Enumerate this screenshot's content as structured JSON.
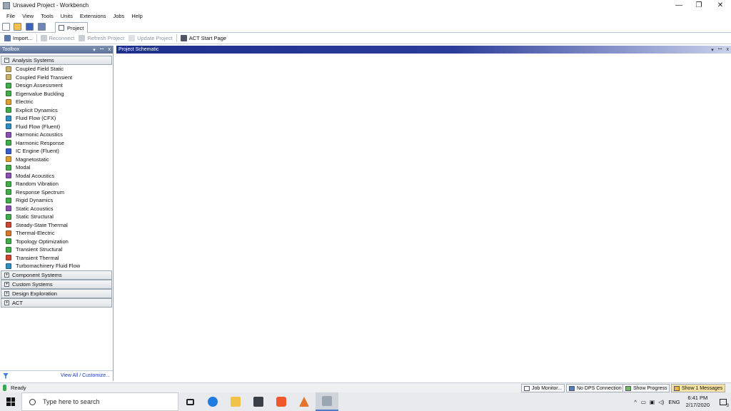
{
  "window": {
    "title": "Unsaved Project - Workbench",
    "min": "—",
    "restore": "❐",
    "close": "✕"
  },
  "menu": [
    "File",
    "View",
    "Tools",
    "Units",
    "Extensions",
    "Jobs",
    "Help"
  ],
  "tab": {
    "label": "Project"
  },
  "toolbar": {
    "import": "Import...",
    "reconnect": "Reconnect",
    "refresh": "Refresh Project",
    "update": "Update Project",
    "act_start": "ACT Start Page"
  },
  "toolbox": {
    "title": "Toolbox",
    "controls": [
      "▾",
      "ꟷ",
      "x"
    ],
    "analysis_group": "Analysis Systems",
    "items": [
      {
        "label": "Coupled Field Static",
        "color": "#c9b26a"
      },
      {
        "label": "Coupled Field Transient",
        "color": "#c9b26a"
      },
      {
        "label": "Design Assessment",
        "color": "#3fae49"
      },
      {
        "label": "Eigenvalue Buckling",
        "color": "#3fae49"
      },
      {
        "label": "Electric",
        "color": "#e0a030"
      },
      {
        "label": "Explicit Dynamics",
        "color": "#3fae49"
      },
      {
        "label": "Fluid Flow (CFX)",
        "color": "#2e8fc4"
      },
      {
        "label": "Fluid Flow (Fluent)",
        "color": "#2e8fc4"
      },
      {
        "label": "Harmonic Acoustics",
        "color": "#8a4fb0"
      },
      {
        "label": "Harmonic Response",
        "color": "#3fae49"
      },
      {
        "label": "IC Engine (Fluent)",
        "color": "#3a5fcf"
      },
      {
        "label": "Magnetostatic",
        "color": "#e0a030"
      },
      {
        "label": "Modal",
        "color": "#3fae49"
      },
      {
        "label": "Modal Acoustics",
        "color": "#8a4fb0"
      },
      {
        "label": "Random Vibration",
        "color": "#3fae49"
      },
      {
        "label": "Response Spectrum",
        "color": "#3fae49"
      },
      {
        "label": "Rigid Dynamics",
        "color": "#3fae49"
      },
      {
        "label": "Static Acoustics",
        "color": "#8a4fb0"
      },
      {
        "label": "Static Structural",
        "color": "#3fae49"
      },
      {
        "label": "Steady-State Thermal",
        "color": "#d2452f"
      },
      {
        "label": "Thermal-Electric",
        "color": "#d9762c"
      },
      {
        "label": "Topology Optimization",
        "color": "#3fae49"
      },
      {
        "label": "Transient Structural",
        "color": "#3fae49"
      },
      {
        "label": "Transient Thermal",
        "color": "#d2452f"
      },
      {
        "label": "Turbomachinery Fluid Flow",
        "color": "#2e8fc4"
      }
    ],
    "groups": [
      "Component Systems",
      "Custom Systems",
      "Design Exploration",
      "ACT"
    ],
    "footer_link": "View All / Customize..."
  },
  "schematic": {
    "title": "Project Schematic",
    "controls": [
      "▾",
      "ꟷ",
      "x"
    ]
  },
  "status": {
    "ready": "Ready",
    "job_monitor": "Job Monitor...",
    "dps": "No DPS Connection",
    "progress": "Show Progress",
    "messages": "Show 1 Messages"
  },
  "taskbar": {
    "search_placeholder": "Type here to search",
    "lang": "ENG",
    "time": "6:41 PM",
    "date": "2/17/2020",
    "notification_count": "3"
  }
}
